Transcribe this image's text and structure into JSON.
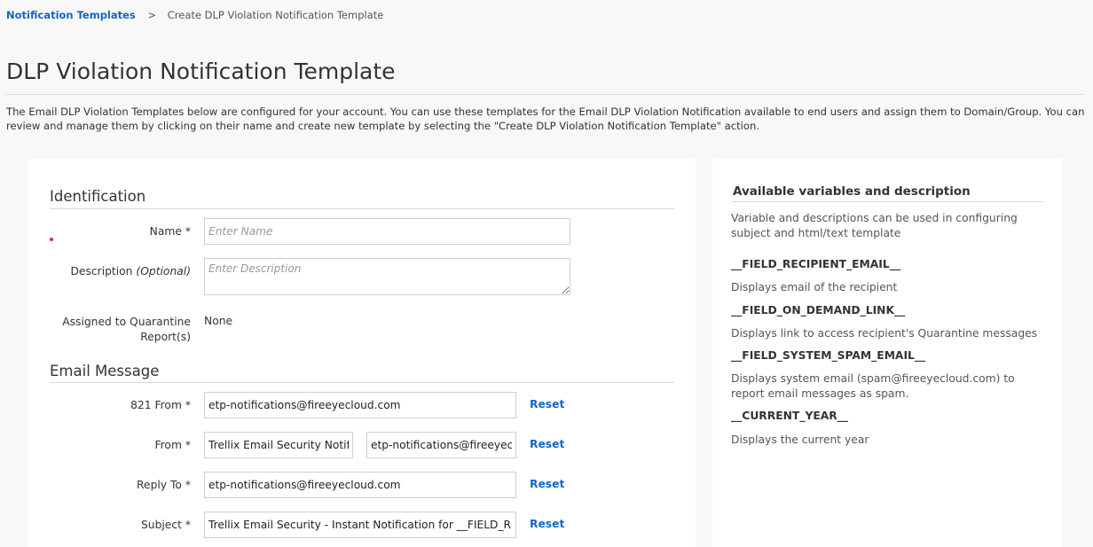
{
  "breadcrumb": {
    "parent": "Notification Templates",
    "separator": ">",
    "current": "Create DLP Violation Notification Template"
  },
  "page": {
    "title": "DLP Violation Notification Template",
    "intro": "The Email DLP Violation Templates below are configured for your account. You can use these templates for the Email DLP Violation Notification available to end users and assign them to Domain/Group. You can review and manage them by clicking on their name and create new template by selecting the \"Create DLP Violation Notification Template\" action."
  },
  "identification": {
    "section_title": "Identification",
    "name_label": "Name *",
    "name_placeholder": "Enter Name",
    "name_value": "",
    "description_label": "Description",
    "description_optional": "(Optional)",
    "description_placeholder": "Enter Description",
    "assigned_label": "Assigned to Quarantine Report(s)",
    "assigned_value": "None"
  },
  "email_message": {
    "section_title": "Email Message",
    "from821_label": "821 From *",
    "from821_value": "etp-notifications@fireeyecloud.com",
    "from_label": "From *",
    "from_name_value": "Trellix Email Security Notific",
    "from_email_value": "etp-notifications@fireeyeclo",
    "reply_to_label": "Reply To *",
    "reply_to_value": "etp-notifications@fireeyecloud.com",
    "subject_label": "Subject *",
    "subject_value": "Trellix Email Security - Instant Notification for __FIELD_RECIF",
    "reset_label": "Reset"
  },
  "variables_panel": {
    "title": "Available variables and description",
    "intro": "Variable and descriptions can be used in configuring subject and html/text template",
    "items": [
      {
        "name": "__FIELD_RECIPIENT_EMAIL__",
        "description": "Displays email of the recipient"
      },
      {
        "name": "__FIELD_ON_DEMAND_LINK__",
        "description": "Displays link to access recipient's Quarantine messages"
      },
      {
        "name": "__FIELD_SYSTEM_SPAM_EMAIL__",
        "description": "Displays system email (spam@fireeyecloud.com) to report email messages as spam."
      },
      {
        "name": "__CURRENT_YEAR__",
        "description": "Displays the current year"
      }
    ]
  },
  "colors": {
    "link": "#1565c0",
    "background": "#f8f8f8",
    "panel": "#ffffff",
    "required_marker": "#d32f2f"
  }
}
